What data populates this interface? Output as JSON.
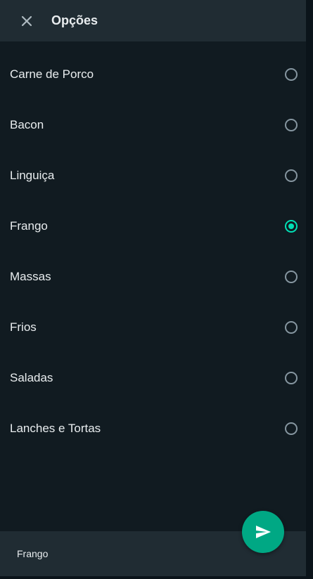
{
  "header": {
    "title": "Opções",
    "close_icon": "close-icon"
  },
  "options": [
    {
      "label": "Carne de Porco",
      "selected": false
    },
    {
      "label": "Bacon",
      "selected": false
    },
    {
      "label": "Linguiça",
      "selected": false
    },
    {
      "label": "Frango",
      "selected": true
    },
    {
      "label": "Massas",
      "selected": false
    },
    {
      "label": "Frios",
      "selected": false
    },
    {
      "label": "Saladas",
      "selected": false
    },
    {
      "label": "Lanches e Tortas",
      "selected": false
    }
  ],
  "footer": {
    "selected_text": "Frango",
    "send_icon": "send-icon"
  },
  "colors": {
    "accent": "#00a884",
    "radio_checked": "#00e0b5",
    "background": "#111b21",
    "header": "#202c33"
  }
}
